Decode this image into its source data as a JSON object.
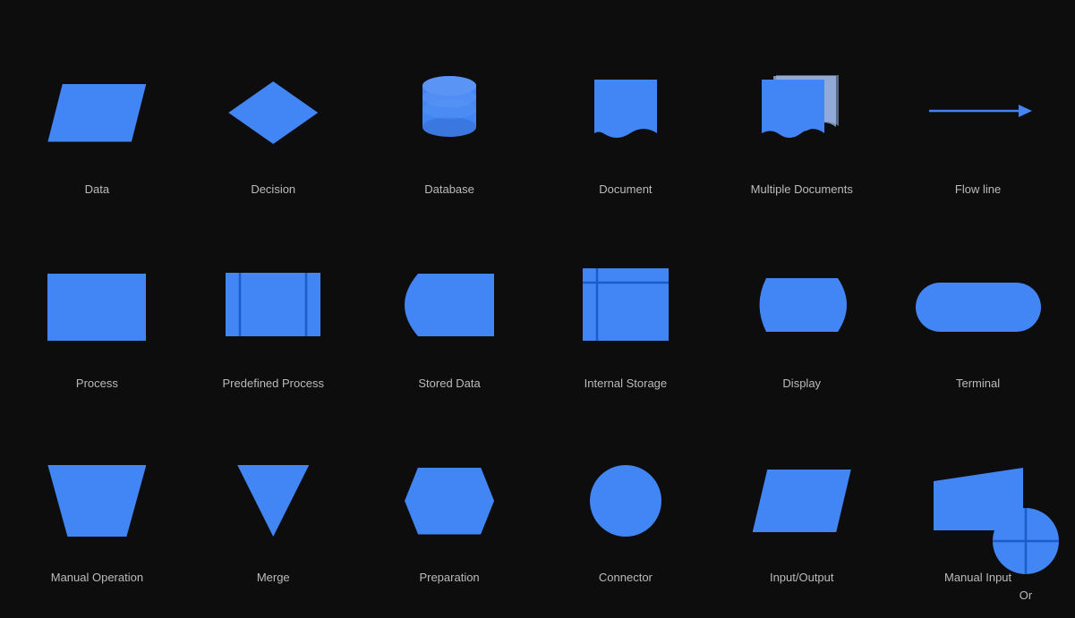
{
  "shapes": [
    {
      "id": "data",
      "label": "Data"
    },
    {
      "id": "decision",
      "label": "Decision"
    },
    {
      "id": "database",
      "label": "Database"
    },
    {
      "id": "document",
      "label": "Document"
    },
    {
      "id": "multiple-documents",
      "label": "Multiple Documents"
    },
    {
      "id": "flow-line",
      "label": "Flow line"
    },
    {
      "id": "process",
      "label": "Process"
    },
    {
      "id": "predefined-process",
      "label": "Predefined Process"
    },
    {
      "id": "stored-data",
      "label": "Stored Data"
    },
    {
      "id": "internal-storage",
      "label": "Internal Storage"
    },
    {
      "id": "display",
      "label": "Display"
    },
    {
      "id": "terminal",
      "label": "Terminal"
    },
    {
      "id": "manual-operation",
      "label": "Manual Operation"
    },
    {
      "id": "merge",
      "label": "Merge"
    },
    {
      "id": "preparation",
      "label": "Preparation"
    },
    {
      "id": "connector",
      "label": "Connector"
    },
    {
      "id": "input-output",
      "label": "Input/Output"
    },
    {
      "id": "manual-input",
      "label": "Manual Input"
    },
    {
      "id": "or",
      "label": "Or"
    }
  ],
  "colors": {
    "blue": "#4285f4",
    "light_blue": "#a8c7fa",
    "bg": "#0d0d0d"
  }
}
